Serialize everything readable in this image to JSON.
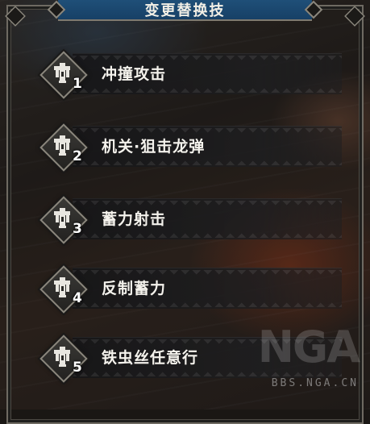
{
  "title": "变更替换技",
  "items": [
    {
      "number": "1",
      "label": "冲撞攻击",
      "icon": "bowgun-icon"
    },
    {
      "number": "2",
      "label": "机关·狙击龙弹",
      "icon": "bowgun-icon"
    },
    {
      "number": "3",
      "label": "蓄力射击",
      "icon": "bowgun-icon"
    },
    {
      "number": "4",
      "label": "反制蓄力",
      "icon": "bowgun-icon"
    },
    {
      "number": "5",
      "label": "铁虫丝任意行",
      "icon": "bowgun-icon"
    }
  ],
  "watermark": {
    "logo": "NGA",
    "url": "BBS.NGA.CN"
  },
  "colors": {
    "title_bar": "#1f4f78",
    "text": "#f4f2ec",
    "frame": "#8a867c"
  }
}
